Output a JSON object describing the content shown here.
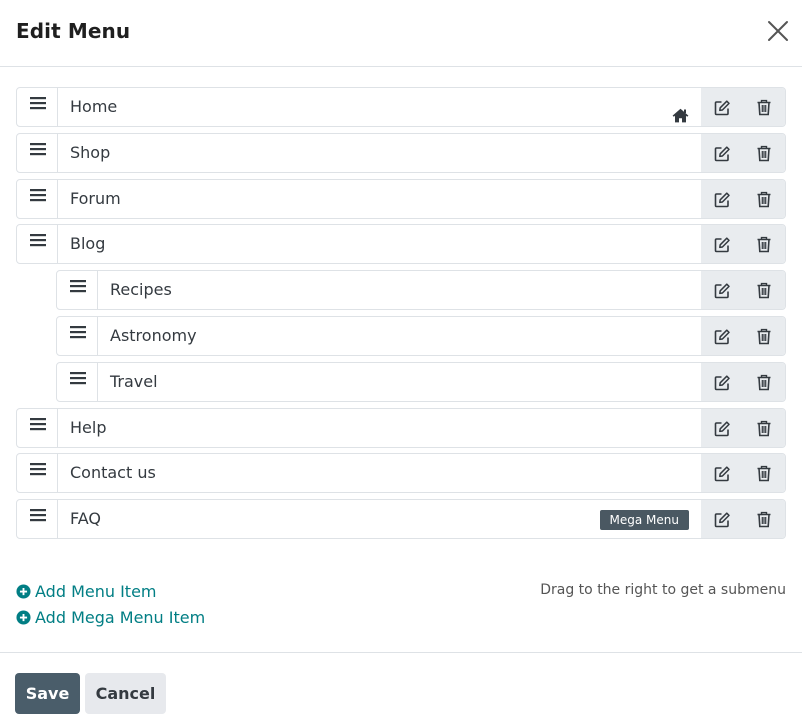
{
  "dialog": {
    "title": "Edit Menu",
    "close_icon": "close-icon"
  },
  "menu_items": [
    {
      "label": "Home",
      "level": 0,
      "home": true
    },
    {
      "label": "Shop",
      "level": 0
    },
    {
      "label": "Forum",
      "level": 0
    },
    {
      "label": "Blog",
      "level": 0
    },
    {
      "label": "Recipes",
      "level": 1
    },
    {
      "label": "Astronomy",
      "level": 1
    },
    {
      "label": "Travel",
      "level": 1
    },
    {
      "label": "Help",
      "level": 0
    },
    {
      "label": "Contact us",
      "level": 0
    },
    {
      "label": "FAQ",
      "level": 0,
      "badge": "Mega Menu"
    }
  ],
  "add_links": {
    "add_menu_item": "Add Menu Item",
    "add_mega_menu_item": "Add Mega Menu Item"
  },
  "hint": "Drag to the right to get a submenu",
  "footer": {
    "save": "Save",
    "cancel": "Cancel"
  },
  "colors": {
    "accent": "#017e84",
    "save_button": "#4a5d6a",
    "badge": "#4a5862",
    "action_bg": "#e9ecef"
  }
}
